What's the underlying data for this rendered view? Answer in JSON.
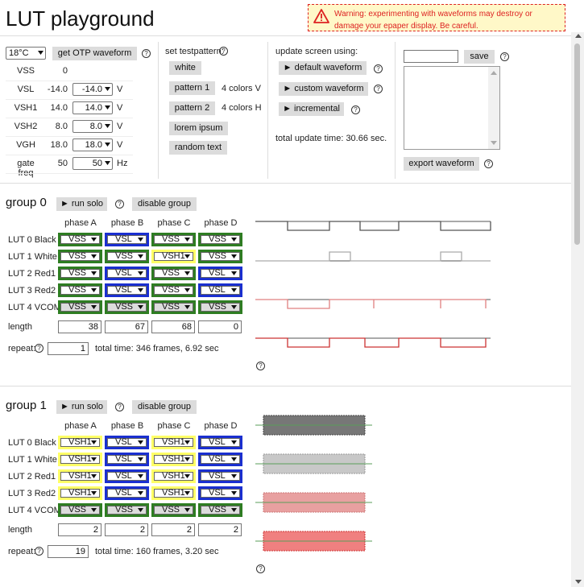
{
  "title": "LUT playground",
  "warning": "Warning: experimenting with waveforms may destroy or damage your epaper display. Be careful.",
  "otp": {
    "temperature": "18°C",
    "get_button": "get OTP waveform",
    "rows": [
      {
        "label": "VSS",
        "value": "0",
        "select": "",
        "unit": ""
      },
      {
        "label": "VSL",
        "value": "-14.0",
        "select": "-14.0",
        "unit": "V"
      },
      {
        "label": "VSH1",
        "value": "14.0",
        "select": "14.0",
        "unit": "V"
      },
      {
        "label": "VSH2",
        "value": "8.0",
        "select": "8.0",
        "unit": "V"
      },
      {
        "label": "VGH",
        "value": "18.0",
        "select": "18.0",
        "unit": "V"
      },
      {
        "label": "gate freq",
        "value": "50",
        "select": "50",
        "unit": "Hz"
      }
    ]
  },
  "testpattern": {
    "label": "set testpattern:",
    "buttons": [
      "white",
      "pattern 1",
      "pattern 2",
      "lorem ipsum",
      "random text"
    ],
    "notes": [
      "4 colors V",
      "4 colors H"
    ]
  },
  "update": {
    "label": "update screen using:",
    "buttons": [
      "► default waveform",
      "► custom waveform",
      "► incremental"
    ],
    "total": "total update time: 30.66 sec."
  },
  "save": {
    "input_value": "",
    "save_label": "save",
    "export_label": "export waveform"
  },
  "groups": [
    {
      "title": "group 0",
      "run_solo": "► run solo",
      "disable": "disable group",
      "phases": [
        "phase A",
        "phase B",
        "phase C",
        "phase D"
      ],
      "rows": [
        {
          "label": "LUT 0 Black",
          "cells": [
            "VSS",
            "VSL",
            "VSS",
            "VSS"
          ]
        },
        {
          "label": "LUT 1 White",
          "cells": [
            "VSS",
            "VSS",
            "VSH1",
            "VSS"
          ]
        },
        {
          "label": "LUT 2 Red1",
          "cells": [
            "VSS",
            "VSL",
            "VSS",
            "VSL"
          ]
        },
        {
          "label": "LUT 3 Red2",
          "cells": [
            "VSS",
            "VSL",
            "VSS",
            "VSL"
          ]
        },
        {
          "label": "LUT 4 VCOM",
          "cells": [
            "VSS",
            "VSS",
            "VSS",
            "VSS"
          ]
        }
      ],
      "length_label": "length",
      "lengths": [
        "38",
        "67",
        "68",
        "0"
      ],
      "repeat_label": "repeat:",
      "repeat": "1",
      "total": "total time: 346 frames, 6.92 sec"
    },
    {
      "title": "group 1",
      "run_solo": "► run solo",
      "disable": "disable group",
      "phases": [
        "phase A",
        "phase B",
        "phase C",
        "phase D"
      ],
      "rows": [
        {
          "label": "LUT 0 Black",
          "cells": [
            "VSH1",
            "VSL",
            "VSH1",
            "VSL"
          ]
        },
        {
          "label": "LUT 1 White",
          "cells": [
            "VSH1",
            "VSL",
            "VSH1",
            "VSL"
          ]
        },
        {
          "label": "LUT 2 Red1",
          "cells": [
            "VSH1",
            "VSL",
            "VSH1",
            "VSL"
          ]
        },
        {
          "label": "LUT 3 Red2",
          "cells": [
            "VSH1",
            "VSL",
            "VSH1",
            "VSL"
          ]
        },
        {
          "label": "LUT 4 VCOM",
          "cells": [
            "VSS",
            "VSS",
            "VSS",
            "VSS"
          ]
        }
      ],
      "length_label": "length",
      "lengths": [
        "2",
        "2",
        "2",
        "2"
      ],
      "repeat_label": "repeat:",
      "repeat": "19",
      "total": "total time: 160 frames, 3.20 sec"
    }
  ],
  "colors": {
    "VSS": "#2e7d22",
    "VSL": "#1a2fd0",
    "VSH1": "#ffff66",
    "VCOM": "#2e7d22",
    "warning_text": "#dd2222",
    "warning_bg": "#fff8c8"
  }
}
